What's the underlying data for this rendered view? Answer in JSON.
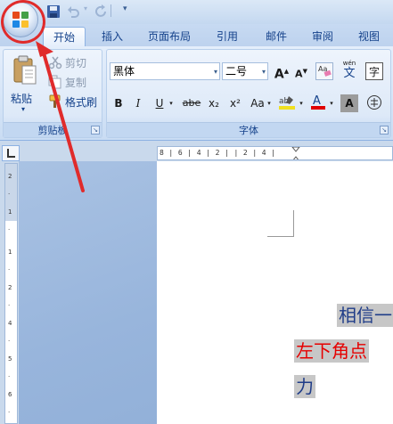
{
  "tabs": [
    {
      "label": "开始",
      "active": true
    },
    {
      "label": "插入"
    },
    {
      "label": "页面布局"
    },
    {
      "label": "引用"
    },
    {
      "label": "邮件"
    },
    {
      "label": "审阅"
    },
    {
      "label": "视图"
    }
  ],
  "clipboard": {
    "paste_label": "粘贴",
    "cut_label": "剪切",
    "copy_label": "复制",
    "format_painter_label": "格式刷",
    "group_label": "剪贴板"
  },
  "font": {
    "font_name": "黑体",
    "font_size": "二号",
    "group_label": "字体",
    "phonetic_label": "wén",
    "phonetic_char": "文",
    "bold": "B",
    "italic": "I",
    "underline": "U",
    "strike": "abe",
    "subscript": "x₂",
    "superscript": "x²",
    "change_case": "Aa",
    "grow": "A",
    "shrink": "A",
    "clear": "A",
    "char_shading": "A",
    "enclose": "字"
  },
  "ruler": {
    "horizontal_text": "8 | 6 | 4 | 2 |   | 2 | 4 |"
  },
  "document": {
    "line1": "相信一",
    "line2": "左下角点",
    "line3": "力"
  },
  "colors": {
    "accent": "#15428b",
    "annotation": "#e02b2b",
    "doc_blue": "#1f3c88",
    "doc_red": "#e60000"
  }
}
